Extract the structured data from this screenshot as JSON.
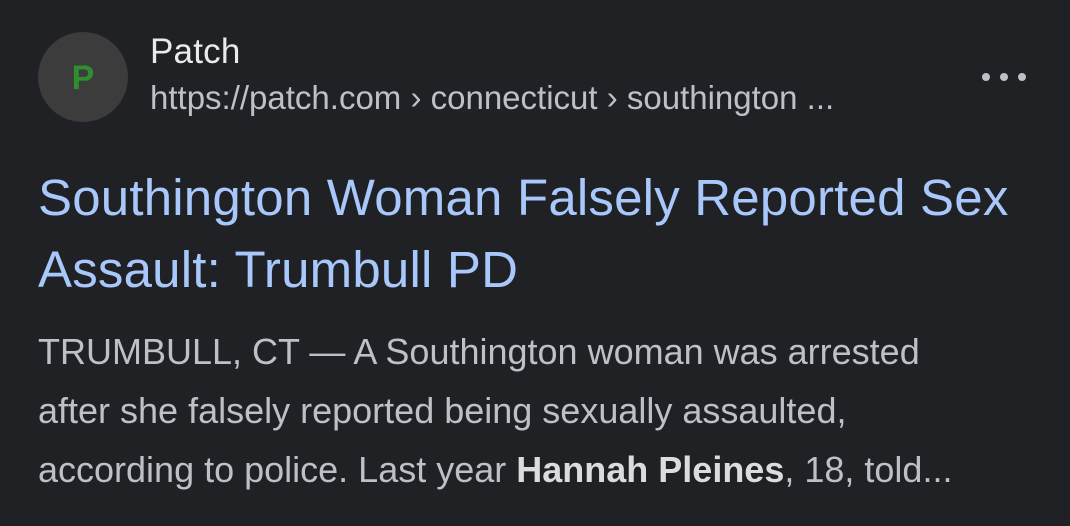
{
  "result": {
    "favicon_letter": "P",
    "site_name": "Patch",
    "url_breadcrumb": "https://patch.com › connecticut › southington ...",
    "headline": "Southington Woman Falsely Reported Sex Assault: Trumbull PD",
    "snippet": {
      "line1": "TRUMBULL, CT — A Southington woman was arrested",
      "line2": "after she falsely reported being sexually assaulted,",
      "line3_prefix": "according to police. Last year ",
      "line3_bold": "Hannah Pleines",
      "line3_suffix": ", 18, told..."
    }
  },
  "icons": {
    "favicon": "patch-logo-icon",
    "more": "more-options-icon"
  },
  "colors": {
    "background": "#202124",
    "headline": "#a8c7fa",
    "text": "#bdc1c6",
    "favicon_bg": "#3c3c3c",
    "favicon_letter": "#2f8f2f"
  }
}
